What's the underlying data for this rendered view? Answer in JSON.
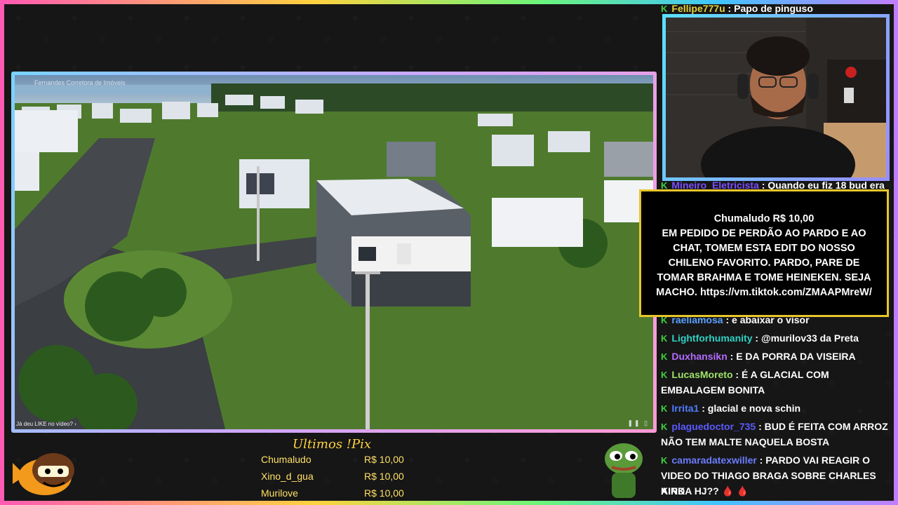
{
  "video": {
    "channel_watermark": "Fernandes Corretora de Imóveis",
    "like_prompt": "Já deu LIKE no vídeo? ›",
    "controls": "❚❚ ▯"
  },
  "donation_alert": {
    "header": "Chumaludo R$ 10,00",
    "lines": [
      "EM PEDIDO DE PERDÃO AO PARDO E AO",
      "CHAT, TOMEM ESTA EDIT DO NOSSO",
      "CHILENO FAVORITO. PARDO, PARE DE",
      "TOMAR BRAHMA E TOME HEINEKEN. SEJA",
      "MACHO. https://vm.tiktok.com/ZMAAPMreW/"
    ]
  },
  "chat": {
    "badge": "K",
    "messages": [
      {
        "user": "Fellipe777u",
        "color": "#e6d23a",
        "text": "Papo de pinguso"
      },
      {
        "user": "Mineiro_Eletricista",
        "color": "#7c4dff",
        "text": "Quando eu fiz 18 bud era"
      },
      {
        "user": "raeliamosa",
        "color": "#5aa0ff",
        "text": "e abaixar o visor"
      },
      {
        "user": "Lightforhumanity",
        "color": "#2fd1c4",
        "text": "@murilov33 da Preta"
      },
      {
        "user": "Duxhansikn",
        "color": "#b36bff",
        "text": "E DA PORRA DA VISEIRA"
      },
      {
        "user": "LucasMoreto",
        "color": "#9fe36a",
        "text": "É A GLACIAL COM"
      },
      {
        "user": "",
        "color": "#fff",
        "text": "EMBALAGEM BONITA"
      },
      {
        "user": "Irrita1",
        "color": "#4f7cff",
        "text": "glacial e nova schin"
      },
      {
        "user": "plaguedoctor_735",
        "color": "#5a5aff",
        "text": "BUD É FEITA COM ARROZ"
      },
      {
        "user": "",
        "color": "#fff",
        "text": "NÃO TEM MALTE NAQUELA BOSTA"
      },
      {
        "user": "camaradatexwiller",
        "color": "#6b7cff",
        "text": "PARDO VAI REAGIR O"
      },
      {
        "user": "",
        "color": "#fff",
        "text": "VIDEO DO THIAGO BRAGA SOBRE CHARLES KIRK"
      },
      {
        "user": "",
        "color": "#fff",
        "text": "AINDA HJ?? 🩸 🩸"
      }
    ]
  },
  "pix": {
    "title": "Ultimos !Pix",
    "rows": [
      {
        "name": "Chumaludo",
        "amount": "R$ 10,00"
      },
      {
        "name": "Xino_d_gua",
        "amount": "R$ 10,00"
      },
      {
        "name": "Murilove",
        "amount": "R$ 10,00"
      }
    ]
  }
}
